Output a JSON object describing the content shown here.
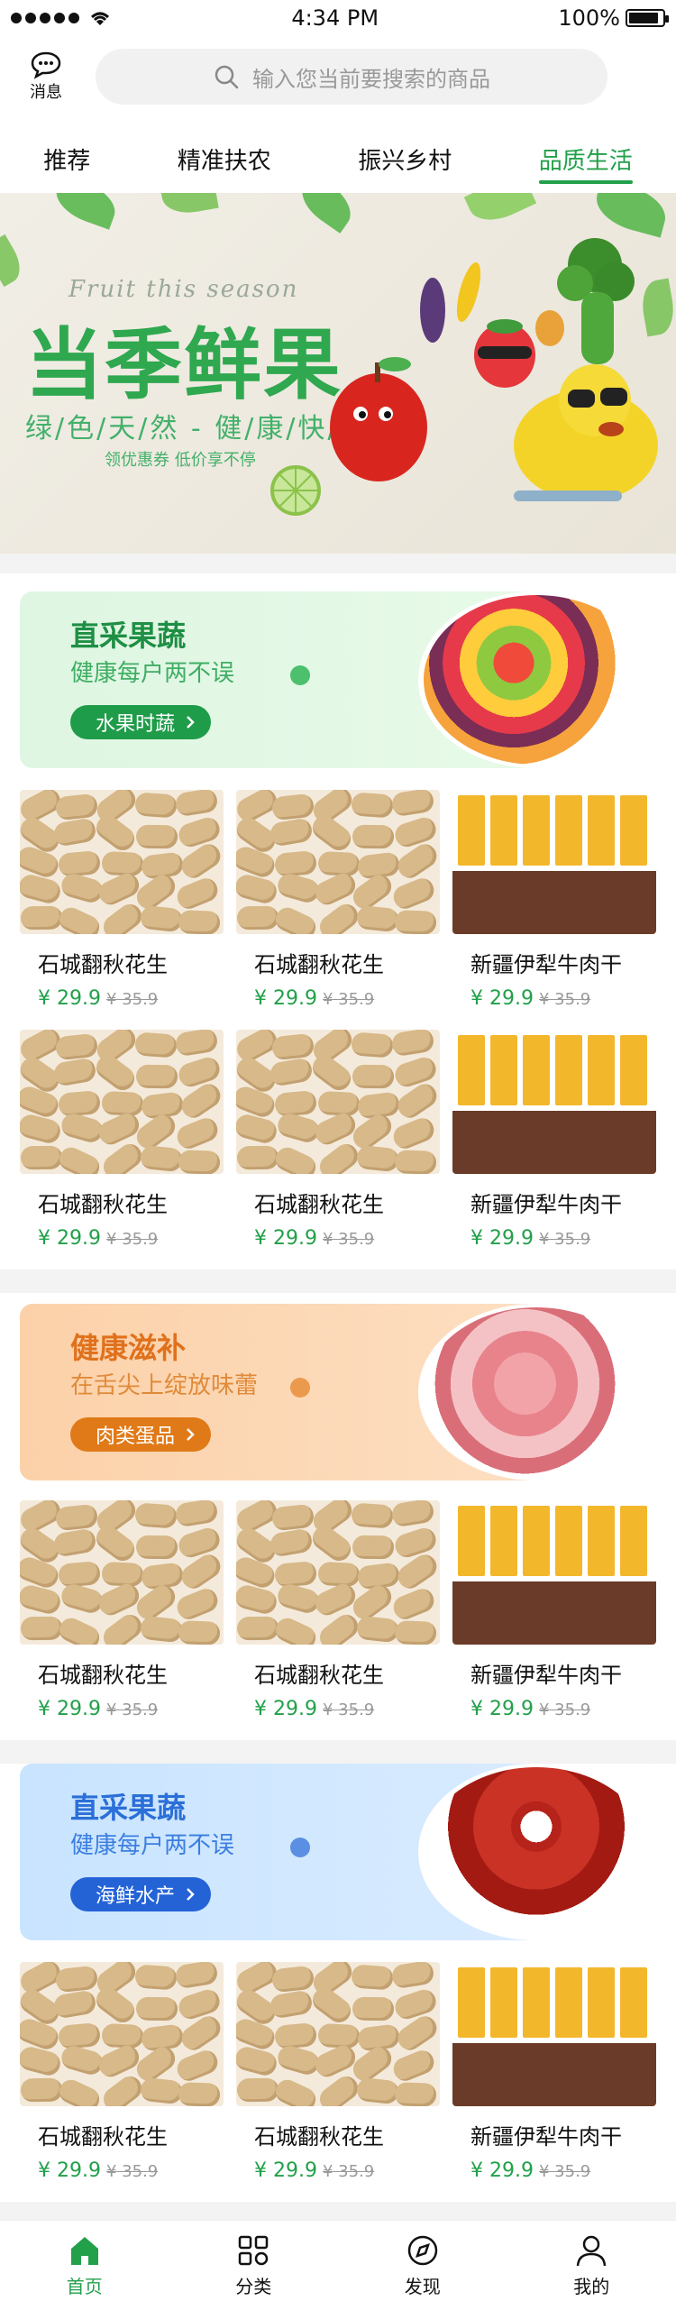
{
  "status": {
    "time": "4:34 PM",
    "battery": "100%"
  },
  "topbar": {
    "message_label": "消息",
    "search_placeholder": "输入您当前要搜索的商品"
  },
  "tabs": [
    {
      "label": "推荐"
    },
    {
      "label": "精准扶农"
    },
    {
      "label": "振兴乡村"
    },
    {
      "label": "品质生活"
    }
  ],
  "hero": {
    "en": "Fruit this season",
    "title": "当季鲜果",
    "subtitle": "绿/色/天/然 - 健/康/快/乐",
    "promo": "领优惠券 低价享不停"
  },
  "sections": [
    {
      "banner": {
        "title": "直采果蔬",
        "subtitle": "健康每户两不误",
        "button": "水果时蔬",
        "theme": "green"
      },
      "products": [
        {
          "name": "石城翻秋花生",
          "price": "¥ 29.9",
          "old": "¥ 35.9"
        },
        {
          "name": "石城翻秋花生",
          "price": "¥ 29.9",
          "old": "¥ 35.9"
        },
        {
          "name": "新疆伊犁牛肉干",
          "price": "¥ 29.9",
          "old": "¥ 35.9"
        },
        {
          "name": "石城翻秋花生",
          "price": "¥ 29.9",
          "old": "¥ 35.9"
        },
        {
          "name": "石城翻秋花生",
          "price": "¥ 29.9",
          "old": "¥ 35.9"
        },
        {
          "name": "新疆伊犁牛肉干",
          "price": "¥ 29.9",
          "old": "¥ 35.9"
        }
      ]
    },
    {
      "banner": {
        "title": "健康滋补",
        "subtitle": "在舌尖上绽放味蕾",
        "button": "肉类蛋品",
        "theme": "orange"
      },
      "products": [
        {
          "name": "石城翻秋花生",
          "price": "¥ 29.9",
          "old": "¥ 35.9"
        },
        {
          "name": "石城翻秋花生",
          "price": "¥ 29.9",
          "old": "¥ 35.9"
        },
        {
          "name": "新疆伊犁牛肉干",
          "price": "¥ 29.9",
          "old": "¥ 35.9"
        }
      ]
    },
    {
      "banner": {
        "title": "直采果蔬",
        "subtitle": "健康每户两不误",
        "button": "海鲜水产",
        "theme": "blue"
      },
      "products": [
        {
          "name": "石城翻秋花生",
          "price": "¥ 29.9",
          "old": "¥ 35.9"
        },
        {
          "name": "石城翻秋花生",
          "price": "¥ 29.9",
          "old": "¥ 35.9"
        },
        {
          "name": "新疆伊犁牛肉干",
          "price": "¥ 29.9",
          "old": "¥ 35.9"
        }
      ]
    }
  ],
  "nav": [
    {
      "label": "首页",
      "icon": "home-icon"
    },
    {
      "label": "分类",
      "icon": "grid-icon"
    },
    {
      "label": "发现",
      "icon": "compass-icon"
    },
    {
      "label": "我的",
      "icon": "user-icon"
    }
  ],
  "colors": {
    "accent": "#22a04a",
    "green_banner": "#dff5e3",
    "orange_banner": "#fbd0a6",
    "blue_banner": "#cfe6ff"
  }
}
